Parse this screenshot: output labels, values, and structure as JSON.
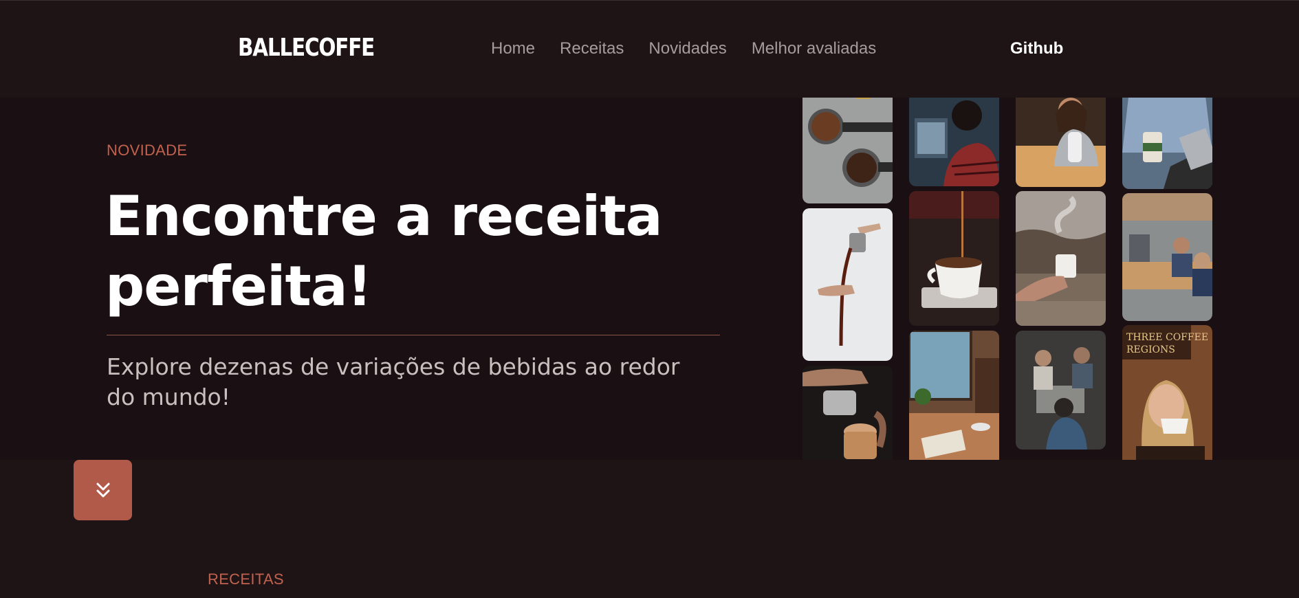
{
  "header": {
    "logo": "BALLECOFFE",
    "nav": [
      {
        "label": "Home"
      },
      {
        "label": "Receitas"
      },
      {
        "label": "Novidades"
      },
      {
        "label": "Melhor avaliadas"
      }
    ],
    "github_label": "Github"
  },
  "hero": {
    "eyebrow": "NOVIDADE",
    "headline_line1": "Encontre a receita",
    "headline_line2": "perfeita!",
    "subtitle": "Explore dezenas de variações de bebidas ao redor do mundo!"
  },
  "gallery": {
    "photos": [
      "coffee-beans-portafilters-photo",
      "pouring-coffee-photo",
      "latte-art-pour-photo",
      "person-at-laptop-photo",
      "espresso-pour-cup-photo",
      "cafe-window-table-photo",
      "barista-woman-photo",
      "steaming-mug-outdoors-photo",
      "baristas-working-photo",
      "coffee-cup-laptop-photo",
      "office-meeting-photo",
      "woman-drinking-coffee-photo"
    ]
  },
  "next_section": {
    "label": "RECEITAS"
  },
  "colors": {
    "background": "#1e1416",
    "hero_background": "#1a1013",
    "accent": "#c2624e",
    "button": "#b25a4a"
  }
}
